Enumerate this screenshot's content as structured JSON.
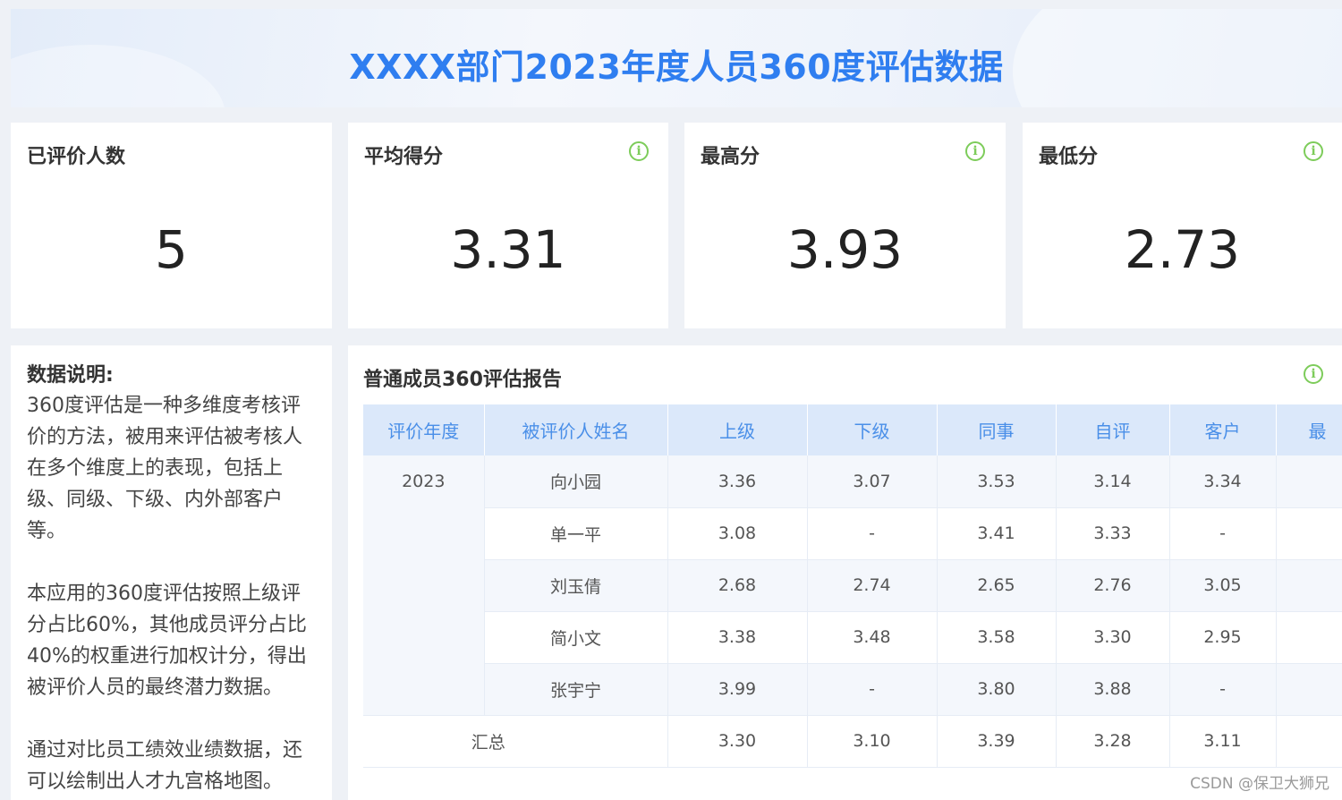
{
  "banner": {
    "title": "XXXX部门2023年度人员360度评估数据"
  },
  "kpis": [
    {
      "label": "已评价人数",
      "value": "5"
    },
    {
      "label": "平均得分",
      "value": "3.31"
    },
    {
      "label": "最高分",
      "value": "3.93"
    },
    {
      "label": "最低分",
      "value": "2.73"
    }
  ],
  "info_icon": {
    "glyph": "i"
  },
  "description": {
    "title": "数据说明:",
    "paragraphs": [
      "360度评估是一种多维度考核评价的方法，被用来评估被考核人在多个维度上的表现，包括上级、同级、下级、内外部客户等。",
      "本应用的360度评估按照上级评分占比60%，其他成员评分占比40%的权重进行加权计分，得出被评价人员的最终潜力数据。",
      "通过对比员工绩效业绩数据，还可以绘制出人才九宫格地图。"
    ]
  },
  "report": {
    "title": "普通成员360评估报告",
    "columns": [
      "评价年度",
      "被评价人姓名",
      "上级",
      "下级",
      "同事",
      "自评",
      "客户",
      "最"
    ],
    "year": "2023",
    "rows": [
      {
        "name": "向小园",
        "superior": "3.36",
        "subordinate": "3.07",
        "colleague": "3.53",
        "self": "3.14",
        "customer": "3.34"
      },
      {
        "name": "单一平",
        "superior": "3.08",
        "subordinate": "-",
        "colleague": "3.41",
        "self": "3.33",
        "customer": "-"
      },
      {
        "name": "刘玉倩",
        "superior": "2.68",
        "subordinate": "2.74",
        "colleague": "2.65",
        "self": "2.76",
        "customer": "3.05"
      },
      {
        "name": "简小文",
        "superior": "3.38",
        "subordinate": "3.48",
        "colleague": "3.58",
        "self": "3.30",
        "customer": "2.95"
      },
      {
        "name": "张宇宁",
        "superior": "3.99",
        "subordinate": "-",
        "colleague": "3.80",
        "self": "3.88",
        "customer": "-"
      }
    ],
    "total": {
      "label": "汇总",
      "superior": "3.30",
      "subordinate": "3.10",
      "colleague": "3.39",
      "self": "3.28",
      "customer": "3.11"
    }
  },
  "watermark": "CSDN @保卫大狮兄",
  "colors": {
    "accent": "#2f7ef0",
    "header_bg": "#dbe8fa",
    "info_green": "#7dcc5a"
  }
}
